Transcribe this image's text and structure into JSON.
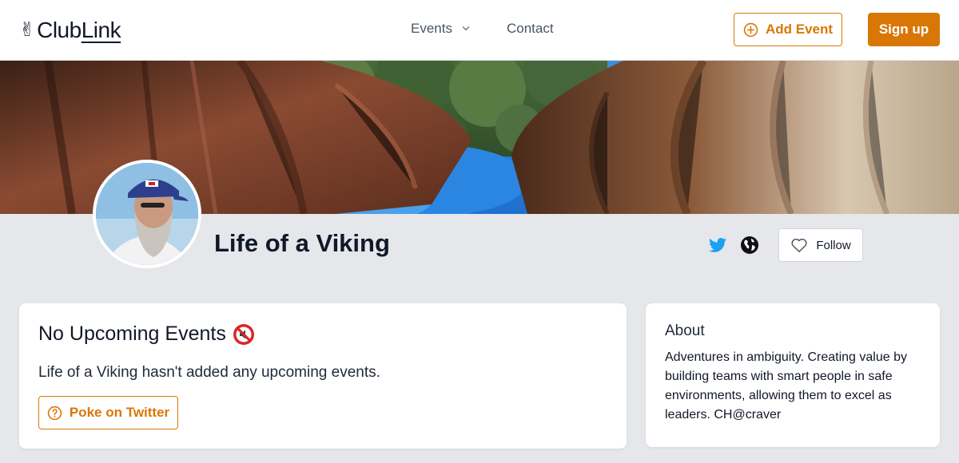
{
  "header": {
    "logo_text_a": "Club",
    "logo_text_b": "Link",
    "nav": [
      {
        "label": "Events"
      },
      {
        "label": "Contact"
      }
    ],
    "add_event_label": "Add Event",
    "signup_label": "Sign up"
  },
  "profile": {
    "name": "Life of a Viking",
    "follow_label": "Follow"
  },
  "events_card": {
    "title": "No Upcoming Events",
    "message": "Life of a Viking hasn't added any upcoming events.",
    "poke_label": "Poke on Twitter"
  },
  "about_card": {
    "title": "About",
    "text": "Adventures in ambiguity. Creating value by building teams with smart people in safe environments, allowing them to excel as leaders. CH@craver"
  },
  "colors": {
    "accent": "#d97706",
    "twitter": "#1da1f2",
    "background": "#e5e7eb"
  },
  "icons": [
    "peace-hand-icon",
    "chevron-down-icon",
    "plus-circle-icon",
    "twitter-icon",
    "globe-icon",
    "heart-icon",
    "no-sound-icon",
    "question-circle-icon"
  ]
}
